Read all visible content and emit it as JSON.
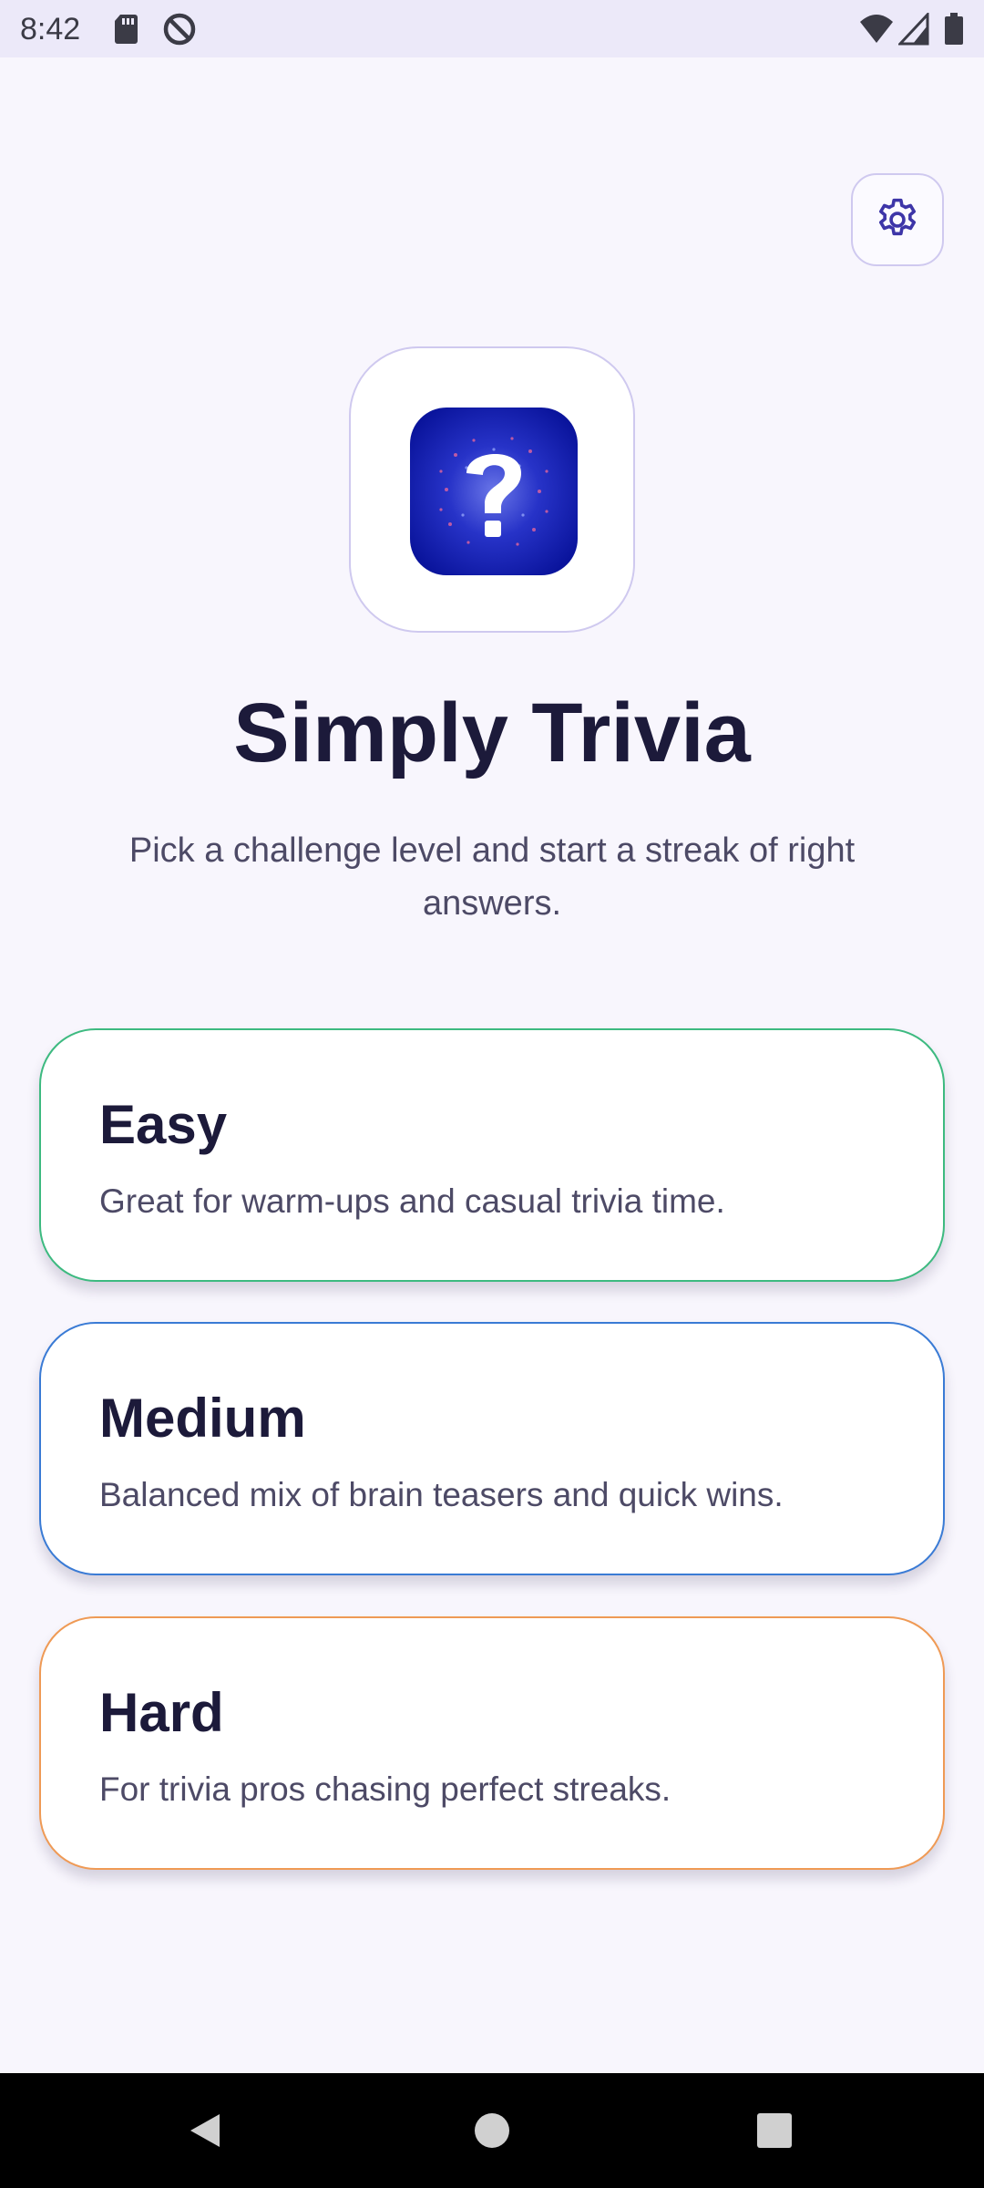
{
  "status_bar": {
    "time": "8:42",
    "left_icons": [
      "sd-card-icon",
      "do-not-disturb-icon"
    ],
    "right_icons": [
      "wifi-icon",
      "cellular-signal-icon",
      "battery-icon"
    ]
  },
  "header": {
    "settings_icon": "gear-icon"
  },
  "hero": {
    "logo_icon": "question-mark-icon",
    "title": "Simply Trivia",
    "subtitle": "Pick a challenge level and start a streak of right answers."
  },
  "levels": [
    {
      "name": "Easy",
      "description": "Great for warm-ups and casual trivia time.",
      "accent": "#3dba80"
    },
    {
      "name": "Medium",
      "description": "Balanced mix of brain teasers and quick wins.",
      "accent": "#3a7bd5"
    },
    {
      "name": "Hard",
      "description": "For trivia pros chasing perfect streaks.",
      "accent": "#ef9a55"
    }
  ],
  "nav_bar": {
    "buttons": [
      "back-icon",
      "home-icon",
      "recents-icon"
    ]
  },
  "colors": {
    "background": "#f8f6fd",
    "title_text": "#1c1a3a",
    "body_text": "#4d4a66",
    "outline": "#cfc9ef",
    "logo_blue": "#0d1aa8"
  }
}
